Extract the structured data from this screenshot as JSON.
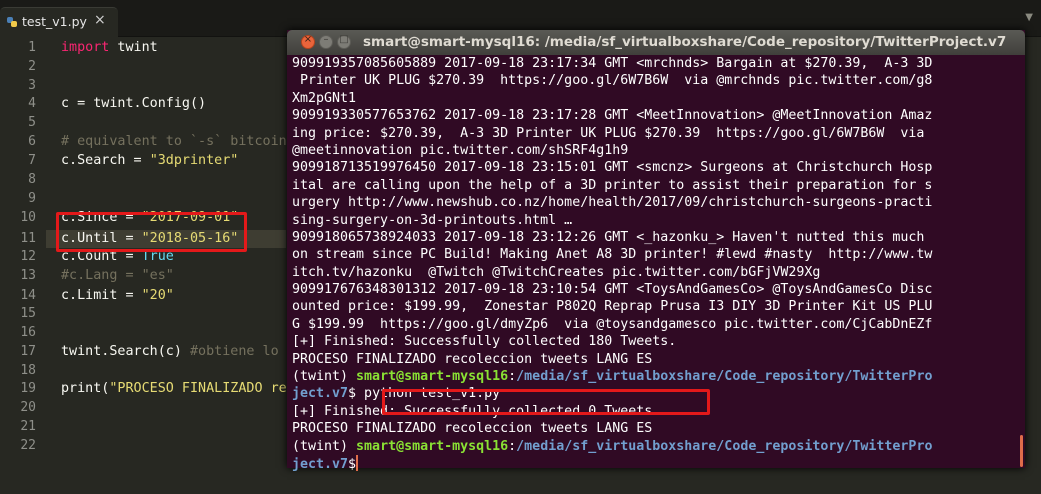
{
  "tab": {
    "title": "test_v1.py",
    "close": "×",
    "icon": "python-file-icon"
  },
  "dropdown_glyph": "▼",
  "editor": {
    "line_numbers": [
      "1",
      "2",
      "3",
      "4",
      "5",
      "6",
      "7",
      "8",
      "9",
      "10",
      "11",
      "12",
      "13",
      "14",
      "15",
      "16",
      "17",
      "18",
      "19",
      "20",
      "21",
      "22"
    ],
    "code": {
      "l1_kw": "import",
      "l1_rest": " twint",
      "l4": "c = twint.Config()",
      "l6": "# equivalent to `-s` bitcoin",
      "l7_a": "c.Search = ",
      "l7_s": "\"3dprinter\"",
      "l10_a": "c.Since = ",
      "l10_s": "\"2017-09-01\"",
      "l11_a": "c.Until = ",
      "l11_s": "\"2018-05-16\"",
      "l12_a": "c.Count = ",
      "l12_b": "True",
      "l13": "#c.Lang = \"es\"",
      "l14_a": "c.Limit = ",
      "l14_s": "\"20\"",
      "l17_a": "twint.Search(c) ",
      "l17_c": "#obtiene lo",
      "l19_a": "print(",
      "l19_s": "\"PROCESO FINALIZADO re"
    }
  },
  "terminal": {
    "title": "smart@smart-mysql16: /media/sf_virtualboxshare/Code_repository/TwitterProject.v7",
    "buttons": {
      "close": "×",
      "min": "–",
      "max": "□"
    },
    "lines": [
      "909919357085605889 2017-09-18 23:17:34 GMT <mrchnds> Bargain at $270.39,  A-3 3D",
      " Printer UK PLUG $270.39  https://goo.gl/6W7B6W  via @mrchnds pic.twitter.com/g8",
      "Xm2pGNt1",
      "909919330577653762 2017-09-18 23:17:28 GMT <MeetInnovation> @MeetInnovation Amaz",
      "ing price: $270.39,  A-3 3D Printer UK PLUG $270.39  https://goo.gl/6W7B6W  via",
      "@meetinnovation pic.twitter.com/shSRF4g1h9",
      "909918713519976450 2017-09-18 23:15:01 GMT <smcnz> Surgeons at Christchurch Hosp",
      "ital are calling upon the help of a 3D printer to assist their preparation for s",
      "urgery http://www.newshub.co.nz/home/health/2017/09/christchurch-surgeons-practi",
      "sing-surgery-on-3d-printouts.html …",
      "909918065738924033 2017-09-18 23:12:26 GMT <_hazonku_> Haven't nutted this much",
      "on stream since PC Build! Making Anet A8 3D printer! #lewd #nasty  http://www.tw",
      "itch.tv/hazonku  @Twitch @TwitchCreates pic.twitter.com/bGFjVW29Xg",
      "909917676348301312 2017-09-18 23:10:54 GMT <ToysAndGamesCo> @ToysAndGamesCo Disc",
      "ounted price: $199.99,  Zonestar P802Q Reprap Prusa I3 DIY 3D Printer Kit US PLU",
      "G $199.99  https://goo.gl/dmyZp6  via @toysandgamesco pic.twitter.com/CjCabDnEZf",
      "[+] Finished: Successfully collected 180 Tweets.",
      "PROCESO FINALIZADO recoleccion tweets LANG ES"
    ],
    "prompt1": {
      "env": "(twint) ",
      "user": "smart@smart-mysql16",
      "sep": ":",
      "path": "/media/sf_virtualboxshare/Code_repository/TwitterPro"
    },
    "prompt1_cont": {
      "path": "ject.v7",
      "tail": "$ python test_v1.py"
    },
    "line_finished0": "[+] Finished: Successfully collected 0 Tweets.",
    "line_proceso2": "PROCESO FINALIZADO recoleccion tweets LANG ES",
    "prompt2": {
      "env": "(twint) ",
      "user": "smart@smart-mysql16",
      "sep": ":",
      "path": "/media/sf_virtualboxshare/Code_repository/TwitterPro"
    },
    "prompt2_cont": {
      "path": "ject.v7",
      "tail": "$"
    }
  },
  "colors": {
    "highlight_box": "#e3191a",
    "terminal_bg": "#300a24",
    "prompt_user": "#8ae234",
    "prompt_path": "#729fcf"
  }
}
